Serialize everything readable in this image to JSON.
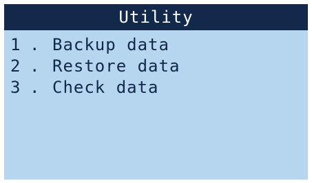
{
  "screen": {
    "title": "Utility",
    "background_color": "#b6d6ef",
    "title_bar_color": "#13294b",
    "text_color": "#10284a"
  },
  "menu": {
    "items": [
      {
        "number": "1",
        "separator": ".",
        "label": "Backup data"
      },
      {
        "number": "2",
        "separator": ".",
        "label": "Restore data"
      },
      {
        "number": "3",
        "separator": ".",
        "label": "Check data"
      }
    ]
  }
}
